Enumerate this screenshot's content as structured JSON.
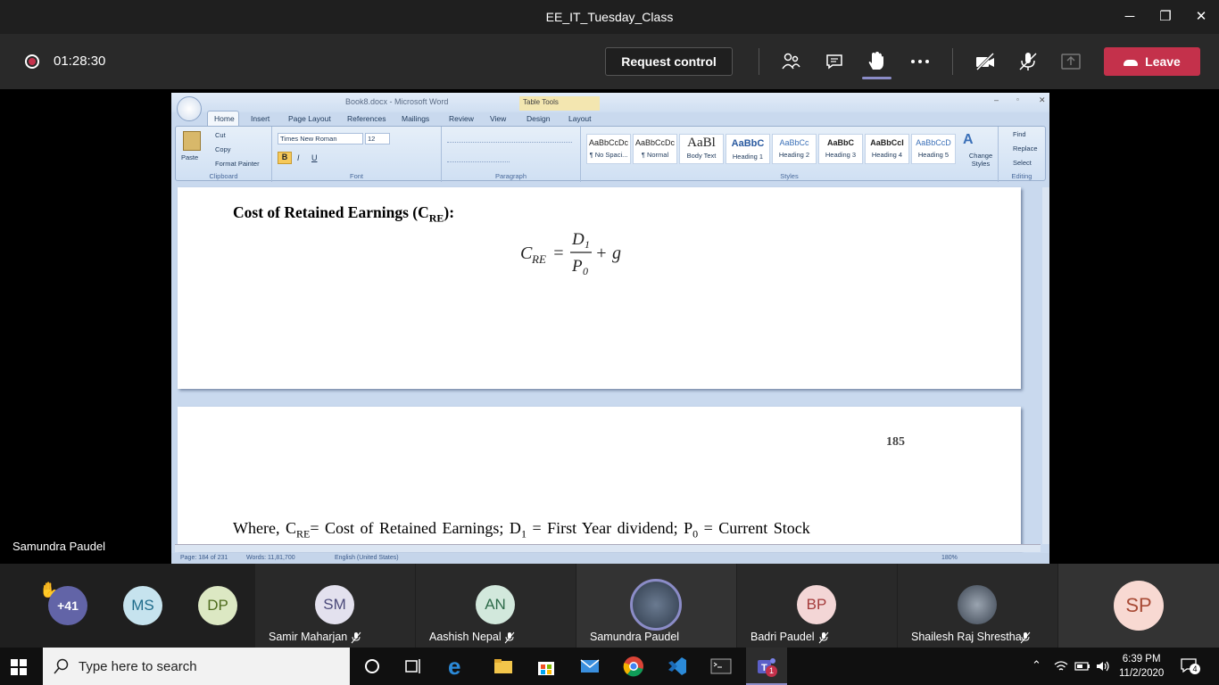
{
  "window": {
    "title": "EE_IT_Tuesday_Class",
    "minimize": "─",
    "restore": "❐",
    "close": "✕"
  },
  "meeting": {
    "timer": "01:28:30",
    "request_control": "Request control",
    "leave": "Leave"
  },
  "presenter_label": "Samundra Paudel",
  "word": {
    "title": "Book8.docx - Microsoft Word",
    "table_tools": "Table Tools",
    "tabs": [
      "Home",
      "Insert",
      "Page Layout",
      "References",
      "Mailings",
      "Review",
      "View",
      "Design",
      "Layout"
    ],
    "clipboard": {
      "paste": "Paste",
      "cut": "Cut",
      "copy": "Copy",
      "format_painter": "Format Painter",
      "group": "Clipboard"
    },
    "font": {
      "name": "Times New Roman",
      "size": "12",
      "group": "Font"
    },
    "paragraph_group": "Paragraph",
    "styles": [
      {
        "preview": "AaBbCcDc",
        "label": "¶ No Spaci..."
      },
      {
        "preview": "AaBbCcDc",
        "label": "¶ Normal"
      },
      {
        "preview": "AaBl",
        "label": "Body Text"
      },
      {
        "preview": "AaBbC",
        "label": "Heading 1"
      },
      {
        "preview": "AaBbCc",
        "label": "Heading 2"
      },
      {
        "preview": "AaBbC",
        "label": "Heading 3"
      },
      {
        "preview": "AaBbCcI",
        "label": "Heading 4"
      },
      {
        "preview": "AaBbCcD",
        "label": "Heading 5"
      }
    ],
    "styles_group": "Styles",
    "change_styles": "Change Styles",
    "editing": {
      "find": "Find",
      "replace": "Replace",
      "select": "Select",
      "group": "Editing"
    },
    "doc": {
      "heading": "Cost of Retained Earnings (C",
      "heading_sub": "RE",
      "heading_end": "):",
      "page_number": "185",
      "where_1": "Where, C",
      "where_sub1": "RE",
      "where_2": "= Cost of Retained Earnings; D",
      "where_sub2": "1",
      "where_3": " = First Year dividend; P",
      "where_sub3": "0",
      "where_4": " = Current Stock"
    },
    "status": {
      "page": "Page: 184 of 231",
      "words": "Words: 11,81,700",
      "language": "English (United States)",
      "zoom": "180%"
    }
  },
  "participants": [
    {
      "initials": "+41",
      "color": "#6264a7",
      "text_color": "#ffffff"
    },
    {
      "initials": "MS",
      "color": "#c6e3ee",
      "text_color": "#1e6b8a"
    },
    {
      "initials": "DP",
      "color": "#dce8c3",
      "text_color": "#4e6b1d"
    },
    {
      "initials": "SM",
      "color": "#e3e1ee",
      "text_color": "#4b4a7a",
      "name": "Samir Maharjan"
    },
    {
      "initials": "AN",
      "color": "#d2e8dc",
      "text_color": "#2e6b4a",
      "name": "Aashish Nepal"
    },
    {
      "initials": "",
      "color": "#555555",
      "text_color": "#ffffff",
      "name": "Samundra Paudel"
    },
    {
      "initials": "BP",
      "color": "#f3d6d6",
      "text_color": "#a43b3b",
      "name": "Badri Paudel"
    },
    {
      "initials": "",
      "color": "#777777",
      "text_color": "#ffffff",
      "name": "Shailesh Raj Shrestha"
    },
    {
      "initials": "SP",
      "color": "#f8d9d2",
      "text_color": "#a84a35"
    }
  ],
  "taskbar": {
    "search_placeholder": "Type here to search",
    "time": "6:39 PM",
    "date": "11/2/2020",
    "notifications": "4",
    "teams_badge": "1"
  }
}
